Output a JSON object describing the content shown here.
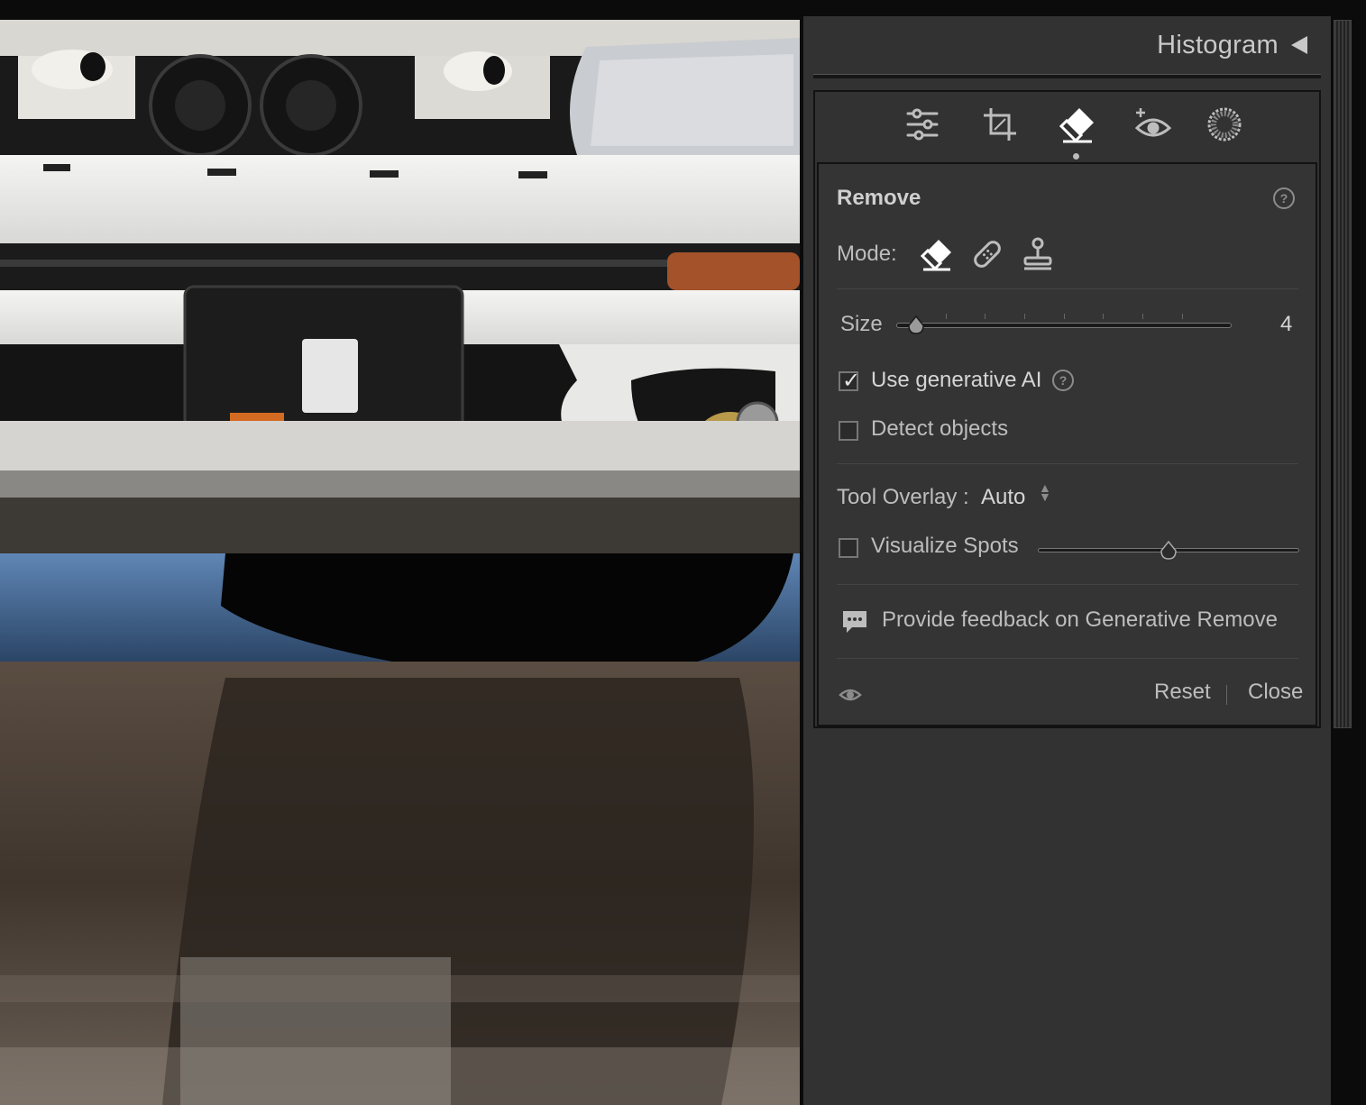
{
  "histogram": {
    "title": "Histogram"
  },
  "toolbar": {
    "tools": [
      {
        "name": "edit-sliders",
        "active": false
      },
      {
        "name": "crop",
        "active": false
      },
      {
        "name": "remove",
        "active": true
      },
      {
        "name": "red-eye",
        "active": false
      },
      {
        "name": "masking",
        "active": false
      }
    ]
  },
  "remove": {
    "title": "Remove",
    "mode_label": "Mode:",
    "mode_selected": "remove",
    "size_label": "Size",
    "size_value": "4",
    "size_fraction": 0.06,
    "use_ai_label": "Use generative AI",
    "use_ai_checked": true,
    "detect_label": "Detect objects",
    "detect_checked": false,
    "overlay_label": "Tool Overlay :",
    "overlay_value": "Auto",
    "visualize_label": "Visualize Spots",
    "visualize_checked": false,
    "visualize_fraction": 0.5,
    "feedback_label": "Provide feedback on Generative Remove",
    "reset_label": "Reset",
    "close_label": "Close"
  }
}
